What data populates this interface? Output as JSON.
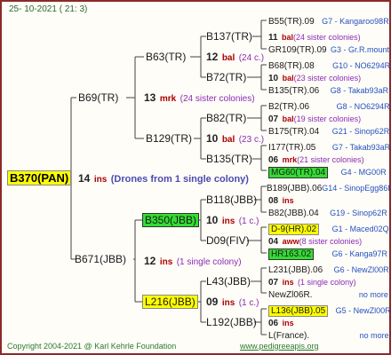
{
  "header": {
    "date": "25- 10-2021 ( 21: 3)"
  },
  "root": {
    "name": "B370(PAN)",
    "count": "14",
    "label": "ins",
    "note": "(Drones from 1 single colony)"
  },
  "level1": [
    {
      "name": "B69(TR)"
    },
    {
      "name": "B671(JBB)",
      "count": "12",
      "label": "ins",
      "note": "(1 single colony)"
    }
  ],
  "level2": [
    {
      "name": "B63(TR)",
      "count": "12",
      "label": "bal",
      "note": "(24 c.)"
    },
    {
      "name": "B129(TR)",
      "count": "10",
      "label": "bal",
      "note": "(23 c.)"
    },
    {
      "name": "B350(JBB)",
      "count": "10",
      "label": "ins",
      "note": "(1 c.)"
    },
    {
      "name": "L216(JBB)",
      "count": "09",
      "label": "ins",
      "note": "(1 c.)"
    }
  ],
  "mid_b69": {
    "count": "13",
    "label": "mrk",
    "note": "(24 sister colonies)"
  },
  "level3": [
    {
      "name": "B137(TR)"
    },
    {
      "name": "B72(TR)"
    },
    {
      "name": "B82(TR)"
    },
    {
      "name": "B135(TR)"
    },
    {
      "name": "B118(JBB)"
    },
    {
      "name": "D09(FIV)"
    },
    {
      "name": "L43(JBB)"
    },
    {
      "name": "L192(JBB)"
    }
  ],
  "level4": [
    {
      "name": "B55(TR).09",
      "info": "G7 - Kangaroo98R"
    },
    {
      "count": "11",
      "label": "bal",
      "note": "(24 sister colonies)"
    },
    {
      "name": "GR109(TR).09",
      "info": "G3 - Gr.R.mounta"
    },
    {
      "name": "B68(TR).08",
      "info": "G10 - NO6294R"
    },
    {
      "count": "10",
      "label": "bal",
      "note": "(23 sister colonies)"
    },
    {
      "name": "B135(TR).06",
      "info": "G8 - Takab93aR"
    },
    {
      "name": "B2(TR).06",
      "info": "G8 - NO6294R"
    },
    {
      "count": "07",
      "label": "bal",
      "note": "(19 sister colonies)"
    },
    {
      "name": "B175(TR).04",
      "info": "G21 - Sinop62R"
    },
    {
      "name": "I177(TR).05",
      "info": "G7 - Takab93aR"
    },
    {
      "count": "06",
      "label": "mrk",
      "note": "(21 sister colonies)"
    },
    {
      "name": "MG60(TR).04",
      "info": "G4 - MG00R"
    },
    {
      "name": "B189(JBB).06",
      "info": "G14 - SinopEgg86R"
    },
    {
      "count": "08",
      "label": "ins",
      "note": ""
    },
    {
      "name": "B82(JBB).04",
      "info": "G19 - Sinop62R"
    },
    {
      "name": "D-9(HR).02",
      "info": "G1 - Maced02Q"
    },
    {
      "count": "04",
      "label": "aww",
      "note": "(8 sister colonies)"
    },
    {
      "name": "HR163.02",
      "info": "G6 - Kanga97R"
    },
    {
      "name": "L231(JBB).06",
      "info": "G6 - NewZl00R"
    },
    {
      "count": "07",
      "label": "ins",
      "note": "(1 single colony)"
    },
    {
      "name": "NewZl06R.",
      "info": "no more"
    },
    {
      "name": "L136(JBB).05",
      "info": "G5 - NewZl00R"
    },
    {
      "count": "06",
      "label": "ins",
      "note": ""
    },
    {
      "name": "L(France).",
      "info": "no more"
    }
  ],
  "footer": {
    "copyright": "Copyright 2004-2021 @ Karl Kehrle Foundation",
    "site": "www.pedigreeapis.org"
  }
}
